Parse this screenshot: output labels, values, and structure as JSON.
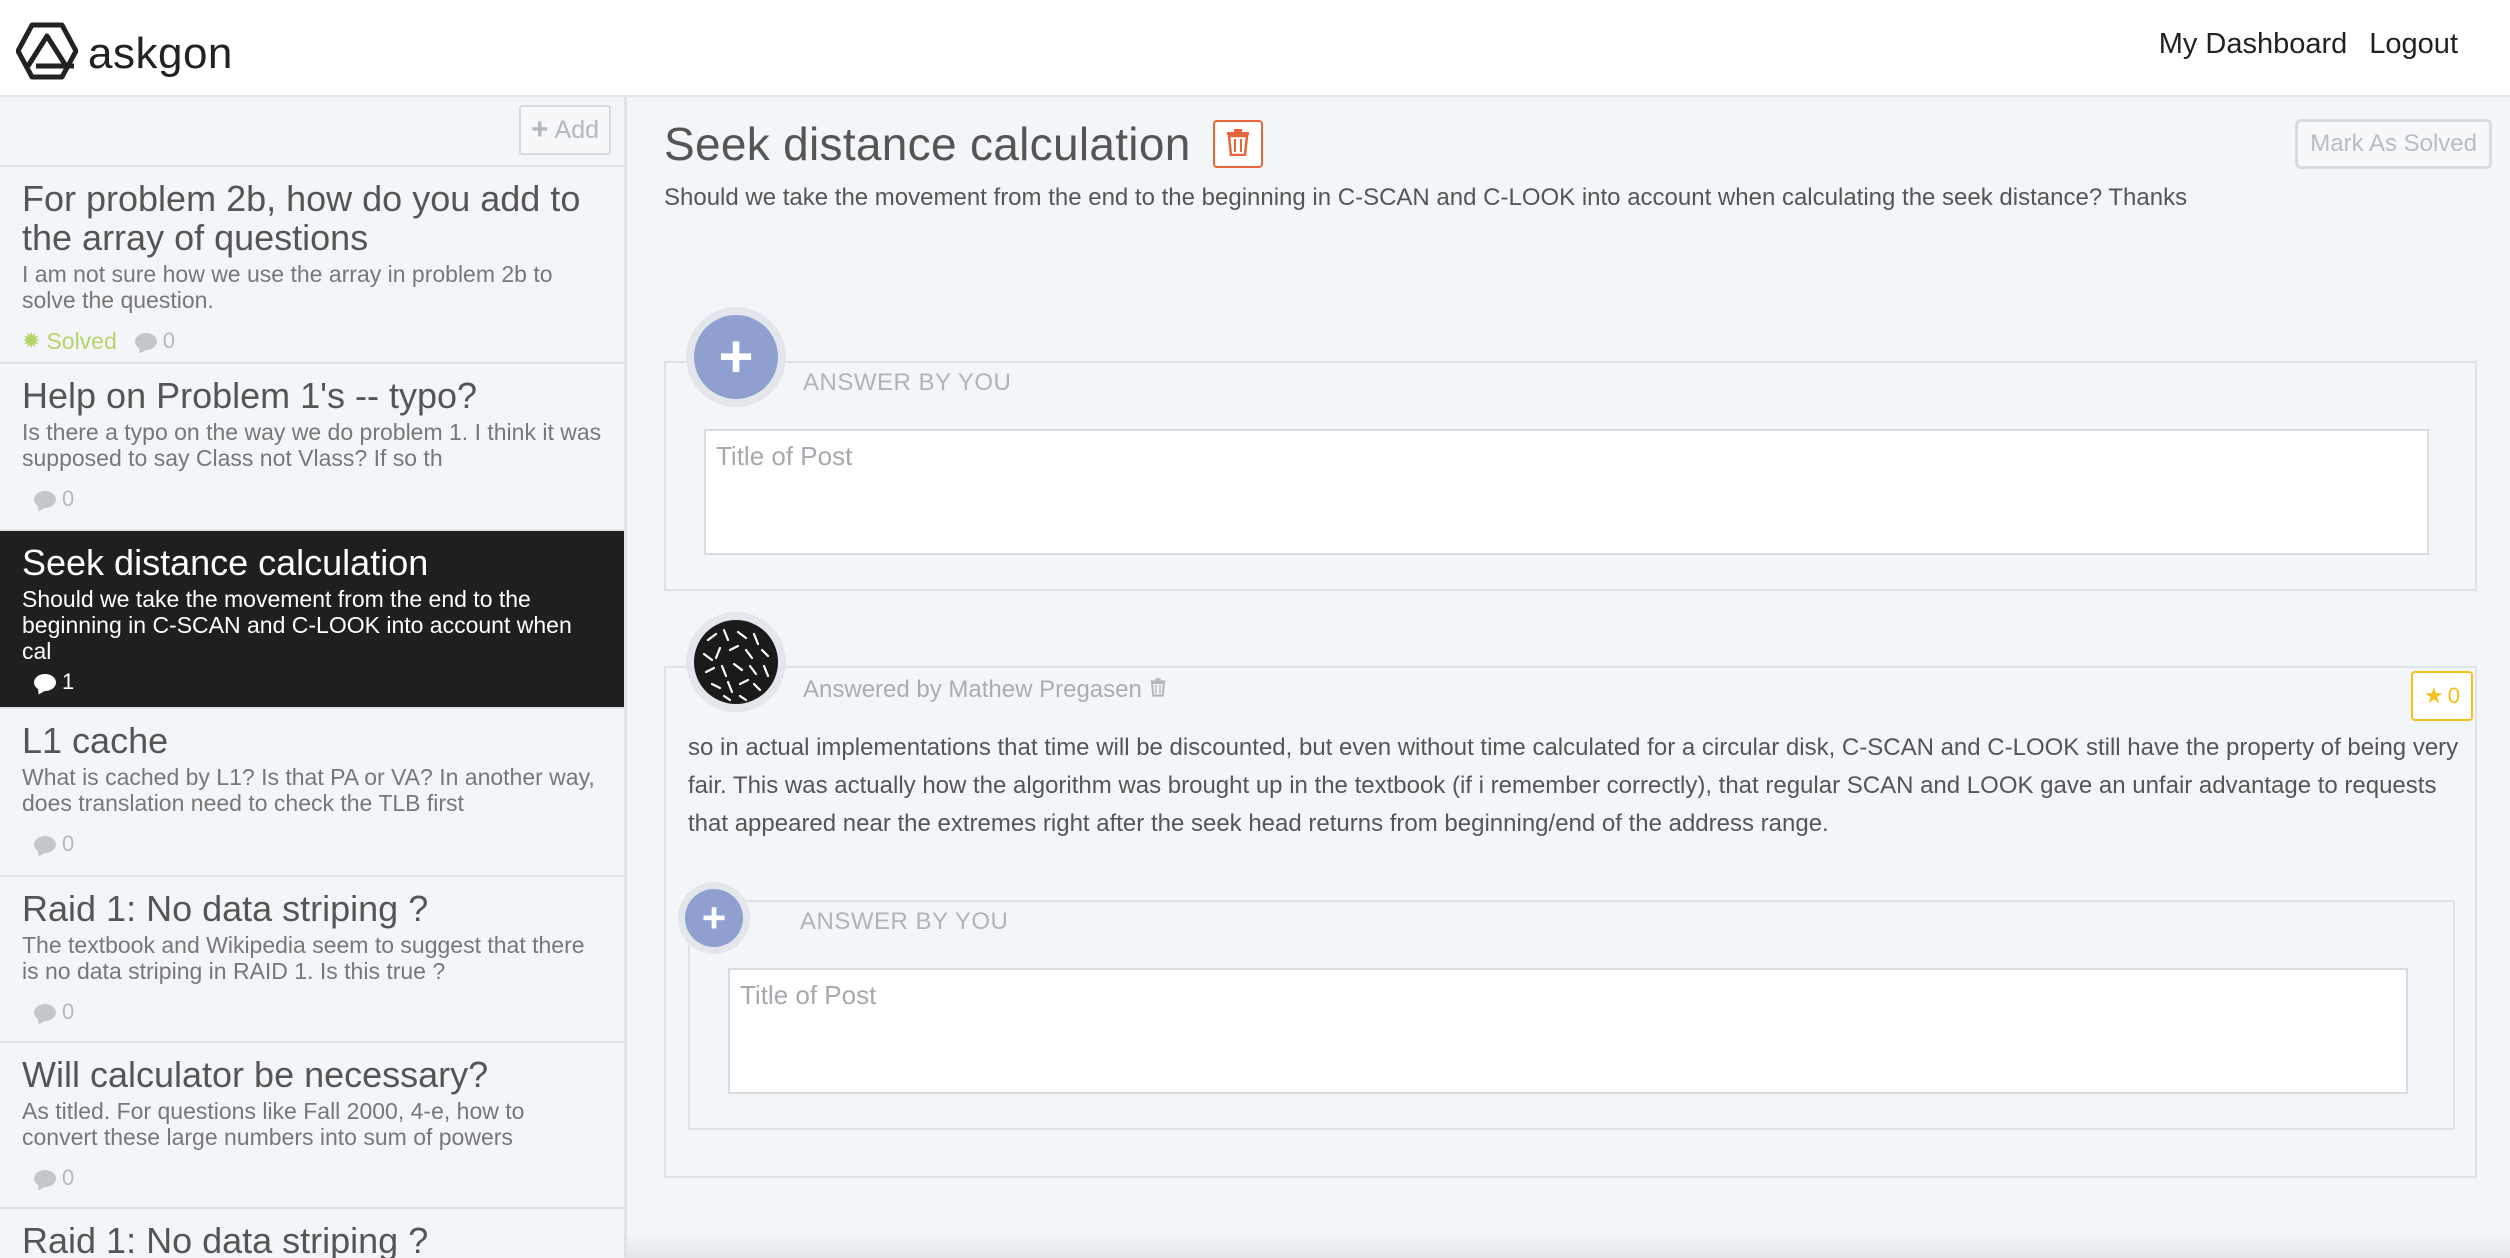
{
  "brand": {
    "name": "askgon"
  },
  "nav": {
    "dashboard": "My Dashboard",
    "logout": "Logout"
  },
  "sidebar": {
    "add_label": "Add",
    "items": [
      {
        "title": "For problem 2b, how do you add to the array of questions",
        "snippet": "I am not sure how we use the array in problem 2b to solve the question.",
        "solved_label": "Solved",
        "comments": "0"
      },
      {
        "title": "Help on Problem 1's -- typo?",
        "snippet": "Is there a typo on the way we do problem 1. I think it was supposed to say Class not Vlass? If so th",
        "comments": "0"
      },
      {
        "title": "Seek distance calculation",
        "snippet": "Should we take the movement from the end to the beginning in C-SCAN and C-LOOK into account when cal",
        "comments": "1"
      },
      {
        "title": "L1 cache",
        "snippet": "What is cached by L1? Is that PA or VA? In another way, does translation need to check the TLB first",
        "comments": "0"
      },
      {
        "title": "Raid 1: No data striping ?",
        "snippet": "The textbook and Wikipedia seem to suggest that there is no data striping in RAID 1. Is this true ?",
        "comments": "0"
      },
      {
        "title": "Will calculator be necessary?",
        "snippet": "As titled. For questions like Fall 2000, 4-e, how to convert these large numbers into sum of powers",
        "comments": "0"
      },
      {
        "title": "Raid 1: No data striping ?"
      }
    ]
  },
  "question": {
    "title": "Seek distance calculation",
    "body": "Should we take the movement from the end to the beginning in C-SCAN and C-LOOK into account when calculating the seek distance? Thanks",
    "mark_solved_label": "Mark As Solved"
  },
  "answer_form": {
    "label": "ANSWER BY YOU",
    "placeholder": "Title of Post"
  },
  "answer": {
    "author_line": "Answered by Mathew Pregasen",
    "text": "so in actual implementations that time will be discounted, but even without time calculated for a circular disk, C-SCAN and C-LOOK still have the property of being very fair. This was actually how the algorithm was brought up in the textbook (if i remember correctly), that regular SCAN and LOOK gave an unfair advantage to requests that appeared near the extremes right after the seek head returns from beginning/end of the address range.",
    "stars": "0"
  },
  "reply_form": {
    "label": "ANSWER BY YOU",
    "placeholder": "Title of Post"
  },
  "colors": {
    "delete": "#e8663b",
    "star": "#f2c21a",
    "solved": "#b7d46b",
    "active_item": "#1f1f1f",
    "plus_avatar": "#8f9fd0"
  }
}
